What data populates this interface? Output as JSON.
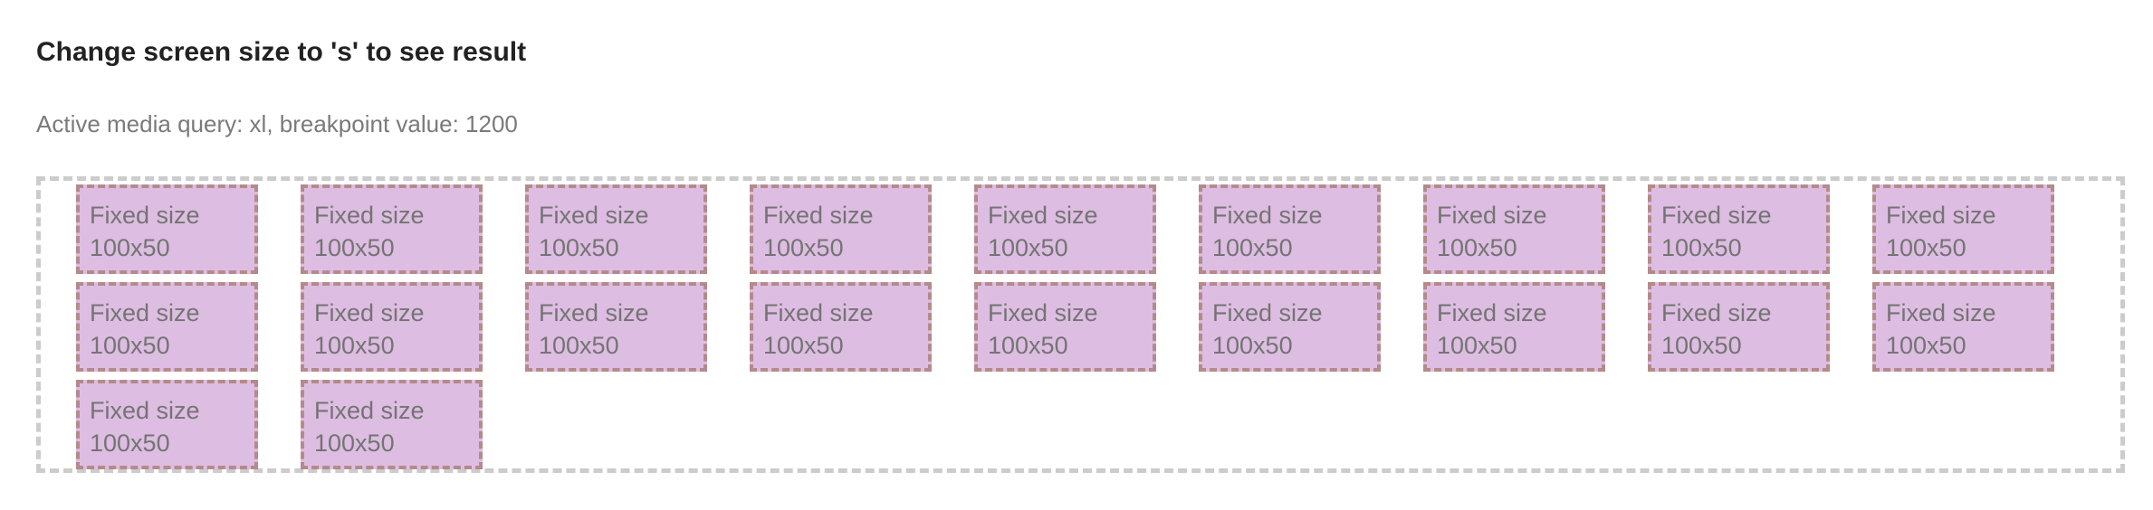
{
  "header": {
    "title": "Change screen size to 's' to see result",
    "media_query_status": "Active media query: xl, breakpoint value: 1200"
  },
  "colors": {
    "box_fill": "#ddbde1",
    "box_border": "#b48a8a",
    "container_border": "#cccccc"
  },
  "boxes": [
    {
      "line1": "Fixed size",
      "line2": "100x50"
    },
    {
      "line1": "Fixed size",
      "line2": "100x50"
    },
    {
      "line1": "Fixed size",
      "line2": "100x50"
    },
    {
      "line1": "Fixed size",
      "line2": "100x50"
    },
    {
      "line1": "Fixed size",
      "line2": "100x50"
    },
    {
      "line1": "Fixed size",
      "line2": "100x50"
    },
    {
      "line1": "Fixed size",
      "line2": "100x50"
    },
    {
      "line1": "Fixed size",
      "line2": "100x50"
    },
    {
      "line1": "Fixed size",
      "line2": "100x50"
    },
    {
      "line1": "Fixed size",
      "line2": "100x50"
    },
    {
      "line1": "Fixed size",
      "line2": "100x50"
    },
    {
      "line1": "Fixed size",
      "line2": "100x50"
    },
    {
      "line1": "Fixed size",
      "line2": "100x50"
    },
    {
      "line1": "Fixed size",
      "line2": "100x50"
    },
    {
      "line1": "Fixed size",
      "line2": "100x50"
    },
    {
      "line1": "Fixed size",
      "line2": "100x50"
    },
    {
      "line1": "Fixed size",
      "line2": "100x50"
    },
    {
      "line1": "Fixed size",
      "line2": "100x50"
    },
    {
      "line1": "Fixed size",
      "line2": "100x50"
    },
    {
      "line1": "Fixed size",
      "line2": "100x50"
    }
  ]
}
